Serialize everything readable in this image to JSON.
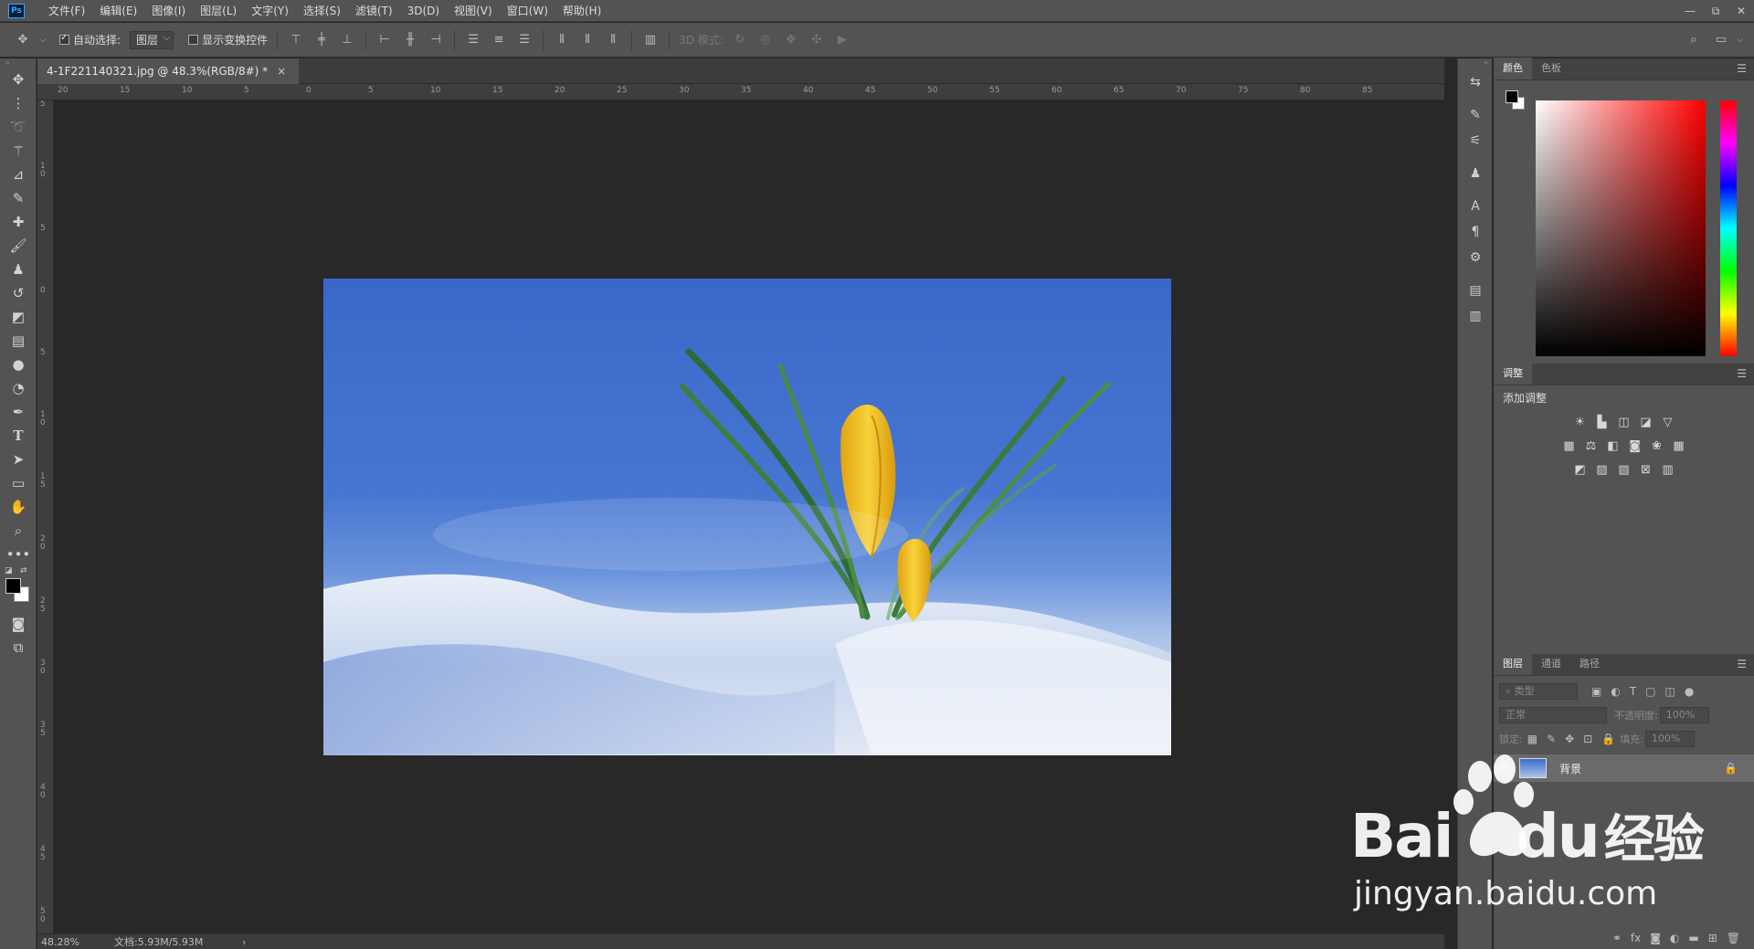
{
  "app": {
    "logo_text": "Ps"
  },
  "menu": [
    "文件(F)",
    "编辑(E)",
    "图像(I)",
    "图层(L)",
    "文字(Y)",
    "选择(S)",
    "滤镜(T)",
    "3D(D)",
    "视图(V)",
    "窗口(W)",
    "帮助(H)"
  ],
  "window_controls": [
    "—",
    "⧉",
    "✕"
  ],
  "options_bar": {
    "auto_select_label": "自动选择:",
    "auto_select_checked": true,
    "auto_select_value": "图层",
    "show_transform_label": "显示变换控件",
    "show_transform_checked": false,
    "mode_3d_label": "3D 模式:"
  },
  "document": {
    "tab_title": "4-1F221140321.jpg @ 48.3%(RGB/8#) *",
    "close_glyph": "×",
    "zoom": "48.28%",
    "doc_info": "文档:5.93M/5.93M",
    "status_arrow": "›"
  },
  "ruler": {
    "h_labels": [
      "20",
      "15",
      "10",
      "5",
      "0",
      "5",
      "10",
      "15",
      "20",
      "25",
      "30",
      "35",
      "40",
      "45",
      "50",
      "55",
      "60",
      "65",
      "70",
      "75",
      "80",
      "85"
    ],
    "v_labels": [
      "5",
      "1 0",
      "5",
      "0",
      "5",
      "1 0",
      "1 5",
      "2 0",
      "2 5",
      "3 0",
      "3 5",
      "4 0",
      "4 5",
      "5 0"
    ]
  },
  "panels": {
    "color_tabs": [
      "颜色",
      "色板"
    ],
    "adjust_tab": "调整",
    "adjust_title": "添加调整",
    "layers_tabs": [
      "图层",
      "通道",
      "路径"
    ],
    "layers": {
      "search_placeholder": "类型",
      "blend_mode": "正常",
      "opacity_label": "不透明度:",
      "opacity_value": "100%",
      "lock_label": "锁定:",
      "fill_label": "填充:",
      "fill_value": "100%",
      "layer_name": "背景"
    }
  },
  "colors": {
    "accent": "#31a8ff",
    "foreground": "#000000",
    "background": "#ffffff",
    "flower": "#f2c21f"
  },
  "watermark": {
    "brand_text": "Bai",
    "brand_text2": "du",
    "cn_text": "经验",
    "url": "jingyan.baidu.com"
  }
}
